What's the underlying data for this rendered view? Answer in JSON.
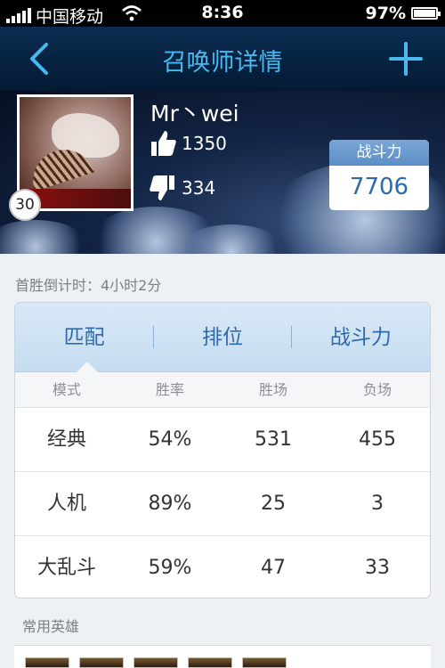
{
  "status_bar": {
    "carrier": "中国移动",
    "time": "8:36",
    "battery": "97%"
  },
  "nav": {
    "title": "召唤师详情"
  },
  "profile": {
    "name": "Mr丶wei",
    "level": "30",
    "likes": "1350",
    "dislikes": "334",
    "power_label": "战斗力",
    "power_value": "7706"
  },
  "countdown": "首胜倒计时：4小时2分",
  "tabs": [
    "匹配",
    "排位",
    "战斗力"
  ],
  "table": {
    "headers": [
      "模式",
      "胜率",
      "胜场",
      "负场"
    ],
    "rows": [
      [
        "经典",
        "54%",
        "531",
        "455"
      ],
      [
        "人机",
        "89%",
        "25",
        "3"
      ],
      [
        "大乱斗",
        "59%",
        "47",
        "33"
      ]
    ]
  },
  "heroes_title": "常用英雄",
  "colors": {
    "accent": "#48b8ef",
    "tab_text": "#2f6aa8",
    "power_value": "#2f6aa8"
  }
}
